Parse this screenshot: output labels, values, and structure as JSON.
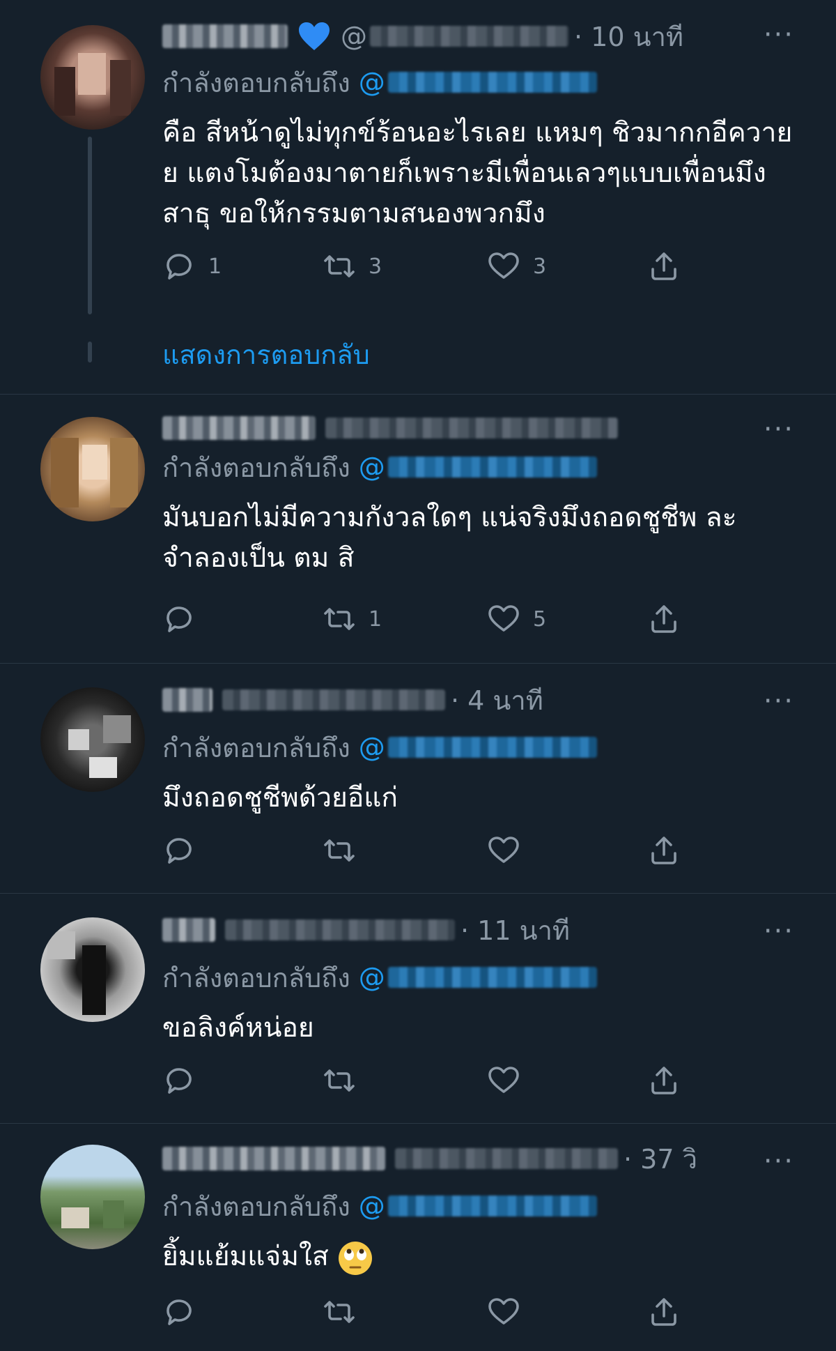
{
  "colors": {
    "background": "#15202b",
    "divider": "#2a3744",
    "secondary_text": "#8b98a5",
    "link": "#1d9bf0",
    "primary_text": "#ffffff"
  },
  "replying_to_label": "กำลังตอบกลับถึง",
  "at_symbol": "@",
  "more_label": "···",
  "show_replies_label": "แสดงการตอบกลับ",
  "tweets": [
    {
      "handle_prefix": "@",
      "time": "· 10 นาที",
      "has_heart_emoji": true,
      "text": "คือ สีหน้าดูไม่ทุกข์ร้อนอะไรเลย แหมๆ ชิวมากกอีควายย แตงโมต้องมาตายก็เพราะมีเพื่อนเลวๆแบบเพื่อนมึง สาธุ ขอให้กรรมตามสนองพวกมึง",
      "counts": {
        "reply": "1",
        "retweet": "3",
        "like": "3"
      }
    },
    {
      "handle_prefix": "",
      "time": "",
      "has_heart_emoji": false,
      "text": "มันบอกไม่มีความกังวลใดๆ แน่จริงมึงถอดชูชีพ ละจำลองเป็น ตม สิ",
      "counts": {
        "reply": "",
        "retweet": "1",
        "like": "5"
      }
    },
    {
      "handle_prefix": "",
      "time": "· 4 นาที",
      "has_heart_emoji": false,
      "text": "มึงถอดชูชีพด้วยอีแก่",
      "counts": {
        "reply": "",
        "retweet": "",
        "like": ""
      }
    },
    {
      "handle_prefix": "",
      "time": "· 11 นาที",
      "has_heart_emoji": false,
      "text": "ขอลิงค์หน่อย",
      "counts": {
        "reply": "",
        "retweet": "",
        "like": ""
      }
    },
    {
      "handle_prefix": "",
      "time": "· 37 วิ",
      "has_heart_emoji": false,
      "text": "ยิ้มแย้มแจ่มใส",
      "counts": {
        "reply": "",
        "retweet": "",
        "like": ""
      }
    }
  ],
  "icons": {
    "reply": "reply-icon",
    "retweet": "retweet-icon",
    "like": "like-icon",
    "share": "share-icon",
    "more": "more-icon",
    "emoji_heart": "blue-heart-emoji-icon",
    "emoji_eyes": "eye-roll-emoji-icon"
  }
}
